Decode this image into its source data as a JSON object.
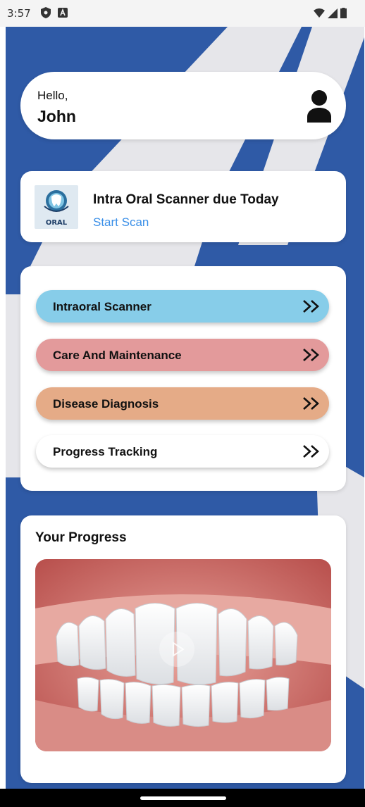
{
  "status_bar": {
    "time": "3:57"
  },
  "greeting": {
    "hello": "Hello,",
    "name": "John"
  },
  "scan_card": {
    "logo_text": "ORAL",
    "title": "Intra Oral Scanner due Today",
    "action": "Start Scan"
  },
  "menu": [
    {
      "label": "Intraoral Scanner",
      "color": "#87cde9"
    },
    {
      "label": "Care And Maintenance",
      "color": "#e39a9b"
    },
    {
      "label": "Disease Diagnosis",
      "color": "#e5ab87"
    },
    {
      "label": "Progress Tracking",
      "color": "#ffffff"
    }
  ],
  "progress": {
    "title": "Your Progress"
  },
  "colors": {
    "background_blue": "#2f5aa6",
    "stripe": "#e6e6ea",
    "link": "#3a8fe8"
  }
}
